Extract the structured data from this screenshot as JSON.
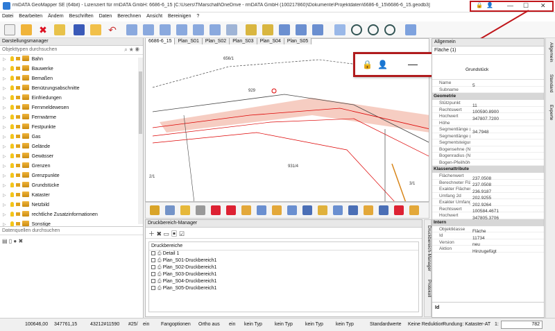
{
  "window": {
    "title": "rmDATA GeoMapper SE (64bit) - Lizenziert für rmDATA GmbH: 6686-6_15 [C:\\Users\\TMarschall\\OneDrive - rmDATA GmbH (100217860)\\Dokumente\\Projektdaten\\6686-6_15\\6686-6_15.geodb3]",
    "controls": {
      "minimize": "—",
      "maximize": "☐",
      "close": "✕"
    }
  },
  "menu": [
    "Datei",
    "Bearbeiten",
    "Ändern",
    "Beschriften",
    "Daten",
    "Berechnen",
    "Ansicht",
    "Bereinigen",
    "?"
  ],
  "left_panel": {
    "title": "Darstellungsmanager",
    "search_placeholder": "Objekttypen durchsuchen",
    "items": [
      "Bahn",
      "Bauwerke",
      "Bemaßen",
      "Benützungsabschnitte",
      "Einfriedungen",
      "Fernmeldewesen",
      "Fernwärme",
      "Festpunkte",
      "Gas",
      "Gelände",
      "Gewässer",
      "Grenzen",
      "Grenzpunkte",
      "Grundstücke",
      "Kataster",
      "Netzbild",
      "rechtliche Zusatzinformationen",
      "Sonstige"
    ],
    "datasource_placeholder": "Datenquellen durchsuchen"
  },
  "tabs": [
    "6686-6_15",
    "Plan_S01",
    "Plan_S02",
    "Plan_S03",
    "Plan_S04",
    "Plan_S05"
  ],
  "map_labels": {
    "l1": "656/1",
    "l2": "929",
    "l3": "931/4",
    "l4": "2/1",
    "l5": "3/1"
  },
  "druck": {
    "title": "Druckbereich-Manager",
    "header": "Druckbereiche",
    "items": [
      "Detail 1",
      "Plan_S01-Druckbereich1",
      "Plan_S02-Druckbereich1",
      "Plan_S03-Druckbereich1",
      "Plan_S04-Druckbereich1",
      "Plan_S05-Druckbereich1"
    ],
    "vtab1": "Druckbereich-Manager",
    "vtab2": "Protokoll"
  },
  "right_panel": {
    "title": "Allgemein",
    "selector": "Fläche (1)",
    "top_value": "Grundstück",
    "rows1": [
      [
        "Name",
        "5"
      ],
      [
        "Subname",
        ""
      ]
    ],
    "sect_geometrie": "Geometrie",
    "rows2": [
      [
        "Stützpunkt",
        "11"
      ],
      [
        "Rechtswert",
        "100590.8900"
      ],
      [
        "Hochwert",
        "347807.7200"
      ],
      [
        "Höhe",
        ""
      ],
      [
        "Segmentlänge (2...",
        "34.7948"
      ],
      [
        "Segmentlänge (3...",
        ""
      ],
      [
        "Segmentsteigun...",
        ""
      ],
      [
        "Bogensehne (Na...",
        ""
      ],
      [
        "Bogenradius (Na...",
        ""
      ],
      [
        "Bogen-Pfeilhöhe ...",
        ""
      ]
    ],
    "sect_klassen": "Klassenattribute",
    "rows3": [
      [
        "Flächenwert",
        "237.0508"
      ],
      [
        "Berechneter Fläc...",
        "237.0508"
      ],
      [
        "Exakter Flächen...",
        "236.9187"
      ],
      [
        "Umfang 2d",
        "202.9255"
      ],
      [
        "Exakter Umfang ...",
        "202.9264"
      ],
      [
        "Rechtswert",
        "100584.4671"
      ],
      [
        "Hochwert",
        "347805.3706"
      ]
    ],
    "sect_intern": "Intern",
    "rows4": [
      [
        "Objektklasse",
        "Fläche"
      ],
      [
        "Id",
        "11734"
      ],
      [
        "Version",
        "neu"
      ],
      [
        "Aktion",
        "Hinzugefügt"
      ]
    ],
    "footer": "Id",
    "side_tabs": [
      "Allgemein",
      "Standard",
      "Experte"
    ]
  },
  "status": {
    "x": "100646,00",
    "y": "347761,15",
    "scale": "43212#11590",
    "hash": "#25/",
    "ein1": "ein",
    "fang": "Fangoptionen",
    "ortho": "Ortho aus",
    "ein2": "ein",
    "kein1": "kein Typ",
    "kein2": "kein Typ",
    "kein3": "kein Typ",
    "kein4": "kein Typ",
    "std": "Standardwerte",
    "reduktion": "Keine Reduktion",
    "rundung": "Rundung: Kataster-AT",
    "one": "1:",
    "zoom": "782"
  },
  "colors": {
    "accent": "#c0161b",
    "highlight": "#f2b8a8"
  }
}
